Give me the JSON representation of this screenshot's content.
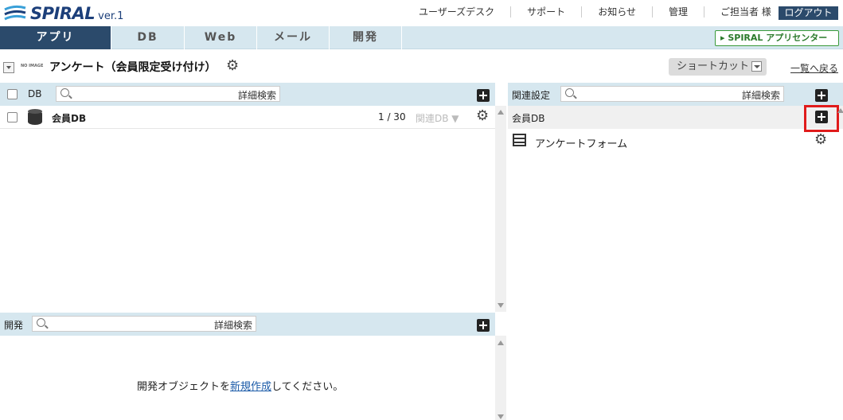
{
  "header": {
    "logo_text": "SPIRAL",
    "logo_version": "ver.1",
    "links": [
      "ユーザーズデスク",
      "サポート",
      "お知らせ",
      "管理",
      "ご担当者 様"
    ],
    "logout": "ログアウト"
  },
  "nav": {
    "tabs": [
      "アプリ",
      "DB",
      "Web",
      "メール",
      "開発"
    ],
    "active": "アプリ",
    "app_center": "▸ SPIRAL アプリセンター"
  },
  "app": {
    "noimage": "NO IMAGE",
    "title": "アンケート（会員限定受け付け）",
    "shortcut": "ショートカット",
    "back": "一覧へ戻る"
  },
  "db_panel": {
    "label": "DB",
    "search_adv": "詳細検索",
    "rows": [
      {
        "name": "会員DB",
        "count": "1 / 30",
        "related": "関連DB ▼"
      }
    ]
  },
  "dev_panel": {
    "label": "開発",
    "search_adv": "詳細検索",
    "empty_before": "開発オブジェクトを",
    "empty_link": "新規作成",
    "empty_after": "してください。"
  },
  "related_panel": {
    "label": "関連設定",
    "search_adv": "詳細検索",
    "group": "会員DB",
    "items": [
      "アンケートフォーム"
    ]
  },
  "colors": {
    "nav_bg": "#d6e7ef",
    "active_tab": "#2b4a6b",
    "highlight": "#e01b1b"
  }
}
